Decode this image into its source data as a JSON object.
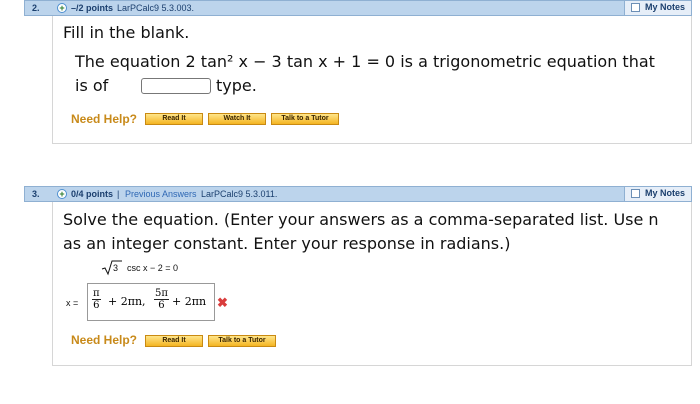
{
  "q2": {
    "number": "2.",
    "points": "–/2 points",
    "source": "LarPCalc9 5.3.003.",
    "notes": "My Notes",
    "instruction": "Fill in the blank.",
    "sentence_line1": "The equation 2 tan² x − 3 tan x + 1 = 0 is a trigonometric equation that",
    "sentence_before_blank": "is of",
    "sentence_after_blank": "type.",
    "blank_value": "",
    "need_help": "Need Help?",
    "buttons": [
      "Read It",
      "Watch It",
      "Talk to a Tutor"
    ]
  },
  "q3": {
    "number": "3.",
    "points": "0/4 points",
    "separator": "|",
    "previous_answers": "Previous Answers",
    "source": "LarPCalc9 5.3.011.",
    "notes": "My Notes",
    "instruction_line1": "Solve the equation. (Enter your answers as a comma-separated list. Use n",
    "instruction_line2": "as an integer constant. Enter your response in radians.)",
    "equation_sqrt": "3",
    "equation_rest": "csc x − 2 = 0",
    "answer_label": "x =",
    "answer": {
      "frac1_num": "π",
      "frac1_den": "6",
      "mid": "+ 2πn,",
      "frac2_num": "5π",
      "frac2_den": "6",
      "end": "+ 2πn"
    },
    "result_mark": "✖",
    "need_help": "Need Help?",
    "buttons": [
      "Read It",
      "Talk to a Tutor"
    ]
  },
  "colors": {
    "header_bar": "#bcd4ec",
    "need_help": "#c88a1a",
    "button": "#f4b522",
    "incorrect": "#d93c3c"
  }
}
